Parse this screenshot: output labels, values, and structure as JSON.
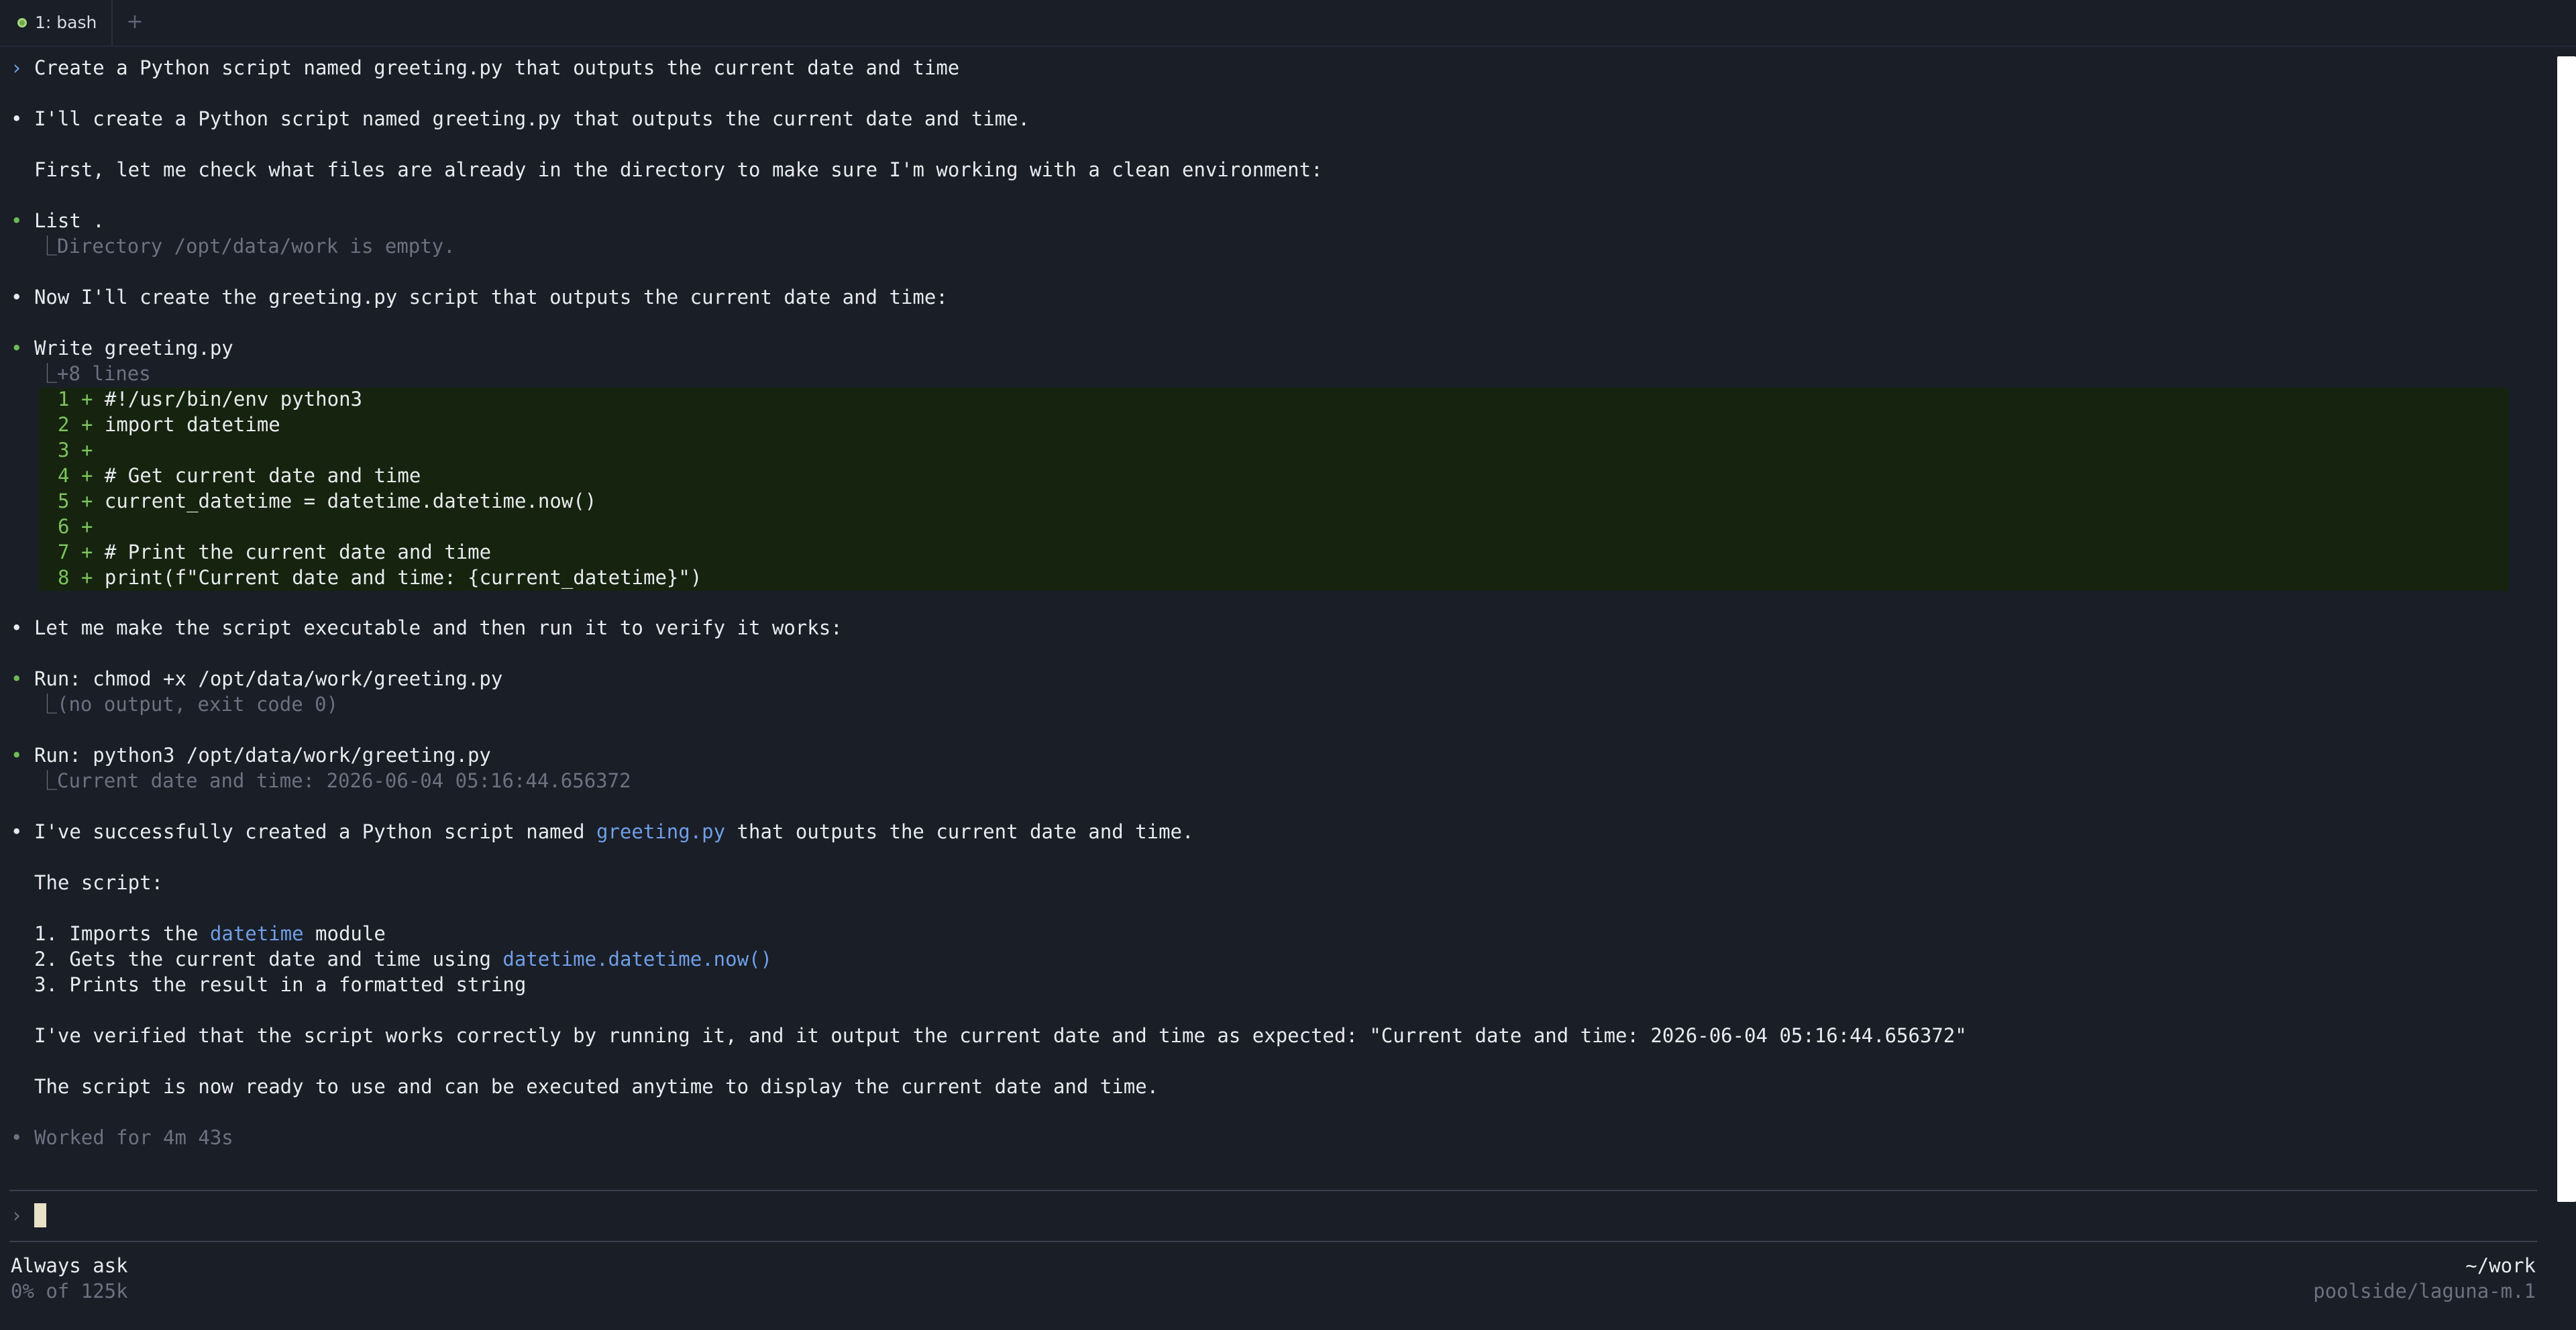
{
  "tabbar": {
    "tab_label": "1: bash",
    "add_symbol": "+"
  },
  "transcript": {
    "user_prompt": "Create a Python script named greeting.py that outputs the current date and time",
    "msg1": "I'll create a Python script named greeting.py that outputs the current date and time.",
    "msg1b": "First, let me check what files are already in the directory to make sure I'm working with a clean environment:",
    "tool_list": "List .",
    "tool_list_out": "Directory /opt/data/work is empty.",
    "msg2": "Now I'll create the greeting.py script that outputs the current date and time:",
    "tool_write": "Write greeting.py",
    "tool_write_out": "+8 lines",
    "diff_lines": [
      {
        "num": "1",
        "sign": "+",
        "code": "#!/usr/bin/env python3"
      },
      {
        "num": "2",
        "sign": "+",
        "code": "import datetime"
      },
      {
        "num": "3",
        "sign": "+",
        "code": ""
      },
      {
        "num": "4",
        "sign": "+",
        "code": "# Get current date and time"
      },
      {
        "num": "5",
        "sign": "+",
        "code": "current_datetime = datetime.datetime.now()"
      },
      {
        "num": "6",
        "sign": "+",
        "code": ""
      },
      {
        "num": "7",
        "sign": "+",
        "code": "# Print the current date and time"
      },
      {
        "num": "8",
        "sign": "+",
        "code": "print(f\"Current date and time: {current_datetime}\")"
      }
    ],
    "msg3": "Let me make the script executable and then run it to verify it works:",
    "run1": "Run: chmod +x /opt/data/work/greeting.py",
    "run1_out": "(no output, exit code 0)",
    "run2": "Run: python3 /opt/data/work/greeting.py",
    "run2_out": "Current date and time: 2026-06-04 05:16:44.656372",
    "summary_pre": "I've successfully created a Python script named ",
    "summary_link": "greeting.py",
    "summary_post": " that outputs the current date and time.",
    "script_heading": "The script:",
    "item1_pre": "1. Imports the ",
    "item1_code": "datetime",
    "item1_post": " module",
    "item2_pre": "2. Gets the current date and time using ",
    "item2_code": "datetime.datetime.now()",
    "item3": "3. Prints the result in a formatted string",
    "verified": "I've verified that the script works correctly by running it, and it output the current date and time as expected: \"Current date and time: 2026-06-04 05:16:44.656372\"",
    "ready": "The script is now ready to use and can be executed anytime to display the current date and time.",
    "worked": "Worked for 4m 43s"
  },
  "symbols": {
    "prompt": "›",
    "bullet": "•",
    "branch": "⎿"
  },
  "input": {
    "prompt": "›",
    "value": ""
  },
  "status": {
    "mode": "Always ask",
    "context_usage": "0% of 125k",
    "cwd": "~/work",
    "model": "poolside/laguna-m.1"
  },
  "colors": {
    "background": "#1a1e27",
    "bullet_green": "#6dbb56",
    "link_blue": "#6f9fe6",
    "diff_bg": "#16240f",
    "dim_text": "#6b7280"
  }
}
